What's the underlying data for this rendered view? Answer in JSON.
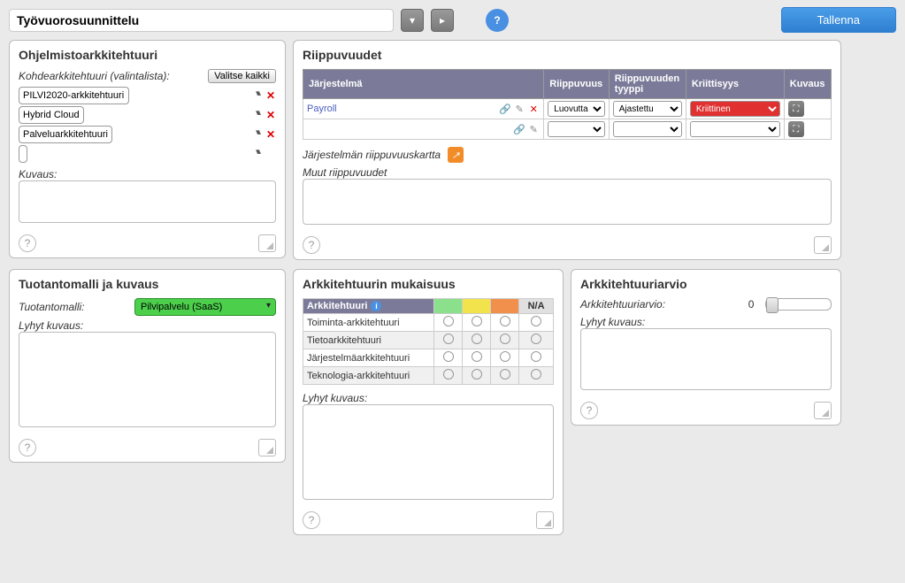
{
  "header": {
    "title": "Työvuorosuunnittelu",
    "save_label": "Tallenna"
  },
  "arch": {
    "heading": "Ohjelmistoarkkitehtuuri",
    "target_label": "Kohdearkkitehtuuri (valintalista):",
    "select_all": "Valitse kaikki",
    "options": [
      "PILVI2020-arkkitehtuuri",
      "Hybrid Cloud",
      "Palveluarkkitehtuuri",
      ""
    ],
    "desc_label": "Kuvaus:"
  },
  "deps": {
    "heading": "Riippuvuudet",
    "cols": {
      "system": "Järjestelmä",
      "dep": "Riippuvuus",
      "deptype": "Riippuvuuden tyyppi",
      "crit": "Kriittisyys",
      "desc": "Kuvaus"
    },
    "rows": [
      {
        "system": "Payroll",
        "dep": "Luovutta",
        "deptype": "Ajastettu",
        "crit": "Kriittinen",
        "crit_red": true
      },
      {
        "system": "",
        "dep": "",
        "deptype": "",
        "crit": "",
        "crit_red": false
      }
    ],
    "map_label": "Järjestelmän riippuvuuskartta",
    "other_label": "Muut riippuvuudet"
  },
  "prod": {
    "heading": "Tuotantomalli ja kuvaus",
    "model_label": "Tuotantomalli:",
    "model_value": "Pilvipalvelu (SaaS)",
    "desc_label": "Lyhyt kuvaus:"
  },
  "comp": {
    "heading": "Arkkitehtuurin mukaisuus",
    "col0": "Arkkitehtuuri",
    "na": "N/A",
    "rows": [
      "Toiminta-arkkitehtuuri",
      "Tietoarkkitehtuuri",
      "Järjestelmäarkkitehtuuri",
      "Teknologia-arkkitehtuuri"
    ],
    "desc_label": "Lyhyt kuvaus:"
  },
  "review": {
    "heading": "Arkkitehtuuriarvio",
    "label": "Arkkitehtuuriarvio:",
    "value": "0",
    "desc_label": "Lyhyt kuvaus:"
  }
}
